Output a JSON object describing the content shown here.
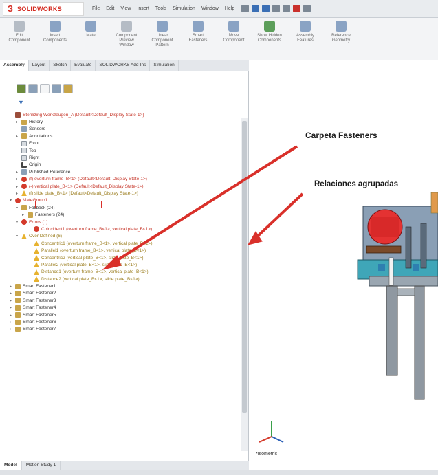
{
  "app": {
    "logo_text": "SOLIDWORKS",
    "menu": [
      "File",
      "Edit",
      "View",
      "Insert",
      "Tools",
      "Simulation",
      "Window",
      "Help"
    ]
  },
  "ribbon": {
    "buttons": [
      "Edit Component",
      "Insert Components",
      "Mate",
      "Component Preview Window",
      "Linear Component Pattern",
      "Smart Fasteners",
      "Move Component",
      "Show Hidden Components",
      "Assembly Features",
      "Reference Geometry"
    ]
  },
  "tabs": [
    "Assembly",
    "Layout",
    "Sketch",
    "Evaluate",
    "SOLIDWORKS Add-Ins",
    "Simulation"
  ],
  "tree": {
    "rows": [
      {
        "label": "Sterilizing Werkzeugen_A  (Default<Default_Display State-1>)",
        "icon": "asm",
        "color": "red",
        "indent": 0,
        "exp": ""
      },
      {
        "label": "History",
        "icon": "folder",
        "color": "",
        "indent": 1,
        "exp": "▸"
      },
      {
        "label": "Sensors",
        "icon": "sensor",
        "color": "",
        "indent": 1,
        "exp": ""
      },
      {
        "label": "Annotations",
        "icon": "folder",
        "color": "",
        "indent": 1,
        "exp": "▸"
      },
      {
        "label": "Front",
        "icon": "plane",
        "color": "",
        "indent": 1,
        "exp": ""
      },
      {
        "label": "Top",
        "icon": "plane",
        "color": "",
        "indent": 1,
        "exp": ""
      },
      {
        "label": "Right",
        "icon": "plane",
        "color": "",
        "indent": 1,
        "exp": ""
      },
      {
        "label": "Origin",
        "icon": "origin",
        "color": "",
        "indent": 1,
        "exp": ""
      },
      {
        "label": "Published Reference",
        "icon": "sensor",
        "color": "",
        "indent": 1,
        "exp": "▸"
      },
      {
        "label": "(f) overturn frame_B<1> (Default<Default_Display State-1>)",
        "icon": "err",
        "color": "red",
        "indent": 1,
        "exp": "▸"
      },
      {
        "label": "(-) vertical plate_B<1> (Default<Default_Display State-1>)",
        "icon": "err",
        "color": "red",
        "indent": 1,
        "exp": "▸"
      },
      {
        "label": "(f) slide plate_B<1> (Default<Default_Display State-1>)",
        "icon": "warn",
        "color": "yellow",
        "indent": 1,
        "exp": "▸"
      },
      {
        "label": "MateGroup1",
        "icon": "err",
        "color": "red",
        "indent": 0,
        "exp": "▾"
      },
      {
        "label": "Fallback (24)",
        "icon": "folder",
        "color": "",
        "indent": 1,
        "exp": "▾"
      },
      {
        "label": "Fasteners (24)",
        "icon": "folder",
        "color": "",
        "indent": 2,
        "exp": "▸"
      },
      {
        "label": "Errors (1)",
        "icon": "err",
        "color": "red",
        "indent": 1,
        "exp": "▾"
      },
      {
        "label": "Coincident1 (overturn frame_B<1>, vertical plate_B<1>)",
        "icon": "err",
        "color": "red",
        "indent": 3,
        "exp": ""
      },
      {
        "label": "Over Defined (6)",
        "icon": "warn",
        "color": "yellow",
        "indent": 1,
        "exp": "▾"
      },
      {
        "label": "Concentric1 (overturn frame_B<1>, vertical plate_B<1>)",
        "icon": "warn",
        "color": "yellow",
        "indent": 3,
        "exp": ""
      },
      {
        "label": "Parallel1 (overturn frame_B<1>, vertical plate_B<1>)",
        "icon": "warn",
        "color": "yellow",
        "indent": 3,
        "exp": ""
      },
      {
        "label": "Concentric2 (vertical plate_B<1>, slide plate_B<1>)",
        "icon": "warn",
        "color": "yellow",
        "indent": 3,
        "exp": ""
      },
      {
        "label": "Parallel2 (vertical plate_B<1>, slide plate_B<1>)",
        "icon": "warn",
        "color": "yellow",
        "indent": 3,
        "exp": ""
      },
      {
        "label": "Distance1 (overturn frame_B<1>, vertical plate_B<1>)",
        "icon": "warn",
        "color": "yellow",
        "indent": 3,
        "exp": ""
      },
      {
        "label": "Distance2 (vertical plate_B<1>, slide plate_B<1>)",
        "icon": "warn",
        "color": "yellow",
        "indent": 3,
        "exp": ""
      },
      {
        "label": "Smart Fastener1",
        "icon": "folder",
        "color": "",
        "indent": 0,
        "exp": "▸"
      },
      {
        "label": "Smart Fastener2",
        "icon": "folder",
        "color": "",
        "indent": 0,
        "exp": "▸"
      },
      {
        "label": "Smart Fastener3",
        "icon": "folder",
        "color": "",
        "indent": 0,
        "exp": "▸"
      },
      {
        "label": "Smart Fastener4",
        "icon": "folder",
        "color": "",
        "indent": 0,
        "exp": "▸"
      },
      {
        "label": "Smart Fastener5",
        "icon": "folder",
        "color": "",
        "indent": 0,
        "exp": "▸"
      },
      {
        "label": "Smart Fastener6",
        "icon": "folder",
        "color": "",
        "indent": 0,
        "exp": "▸"
      },
      {
        "label": "Smart Fastener7",
        "icon": "folder",
        "color": "",
        "indent": 0,
        "exp": "▸"
      }
    ]
  },
  "bottom_tabs": [
    "Model",
    "Motion Study 1"
  ],
  "annotations": {
    "fasteners_folder": "Carpeta Fasteners",
    "grouped_mates": "Relaciones agrupadas"
  },
  "viewport": {
    "view_label": "*Isometric"
  },
  "colors": {
    "annotation_arrow": "#d9302a",
    "error": "#c63528",
    "warning": "#e7b22f",
    "brand": "#d42a20"
  }
}
